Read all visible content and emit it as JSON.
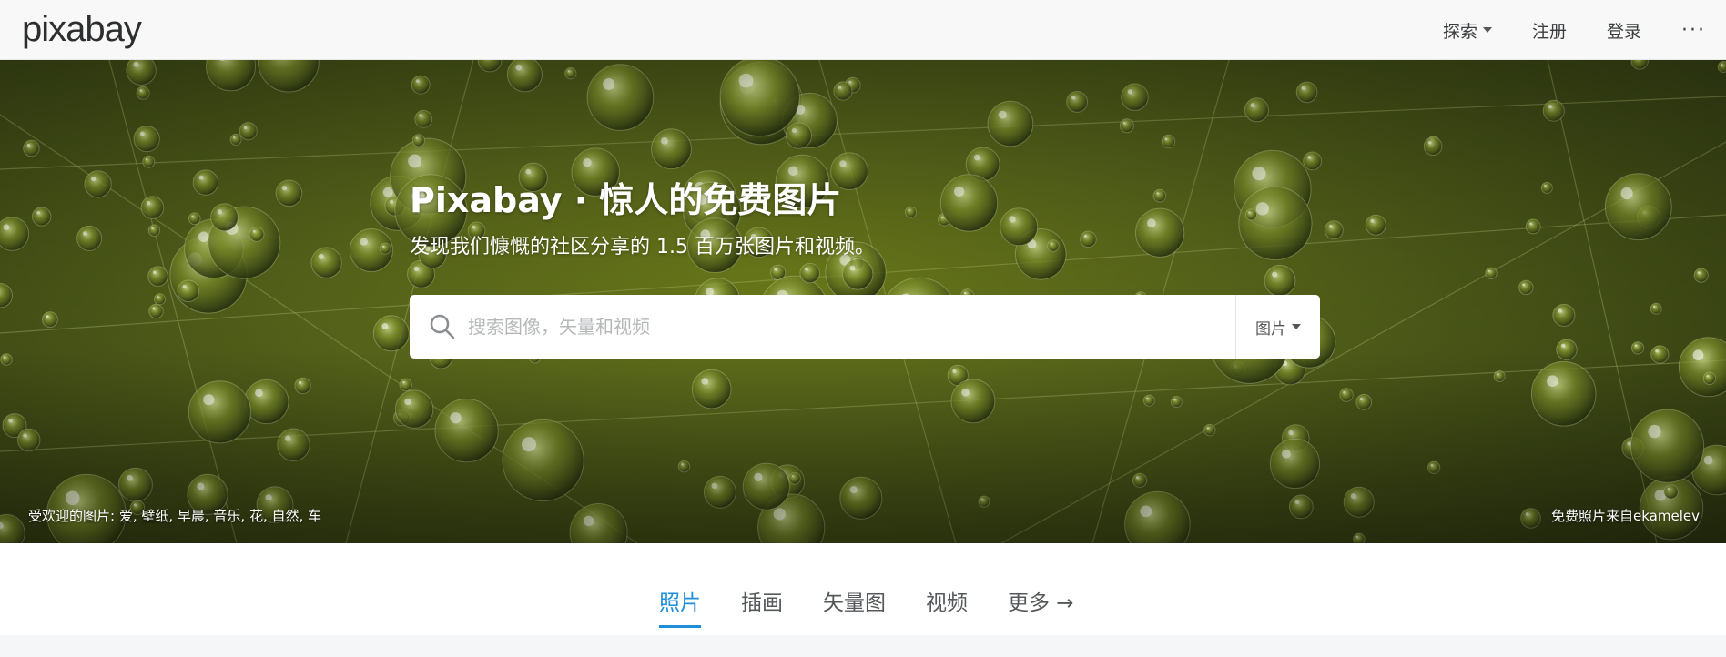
{
  "header": {
    "logo": "pixabay",
    "nav": {
      "explore": "探索",
      "register": "注册",
      "login": "登录",
      "more": "···"
    }
  },
  "hero": {
    "title": "Pixabay · 惊人的免费图片",
    "subtitle": "发现我们慷慨的社区分享的 1.5 百万张图片和视频。",
    "search": {
      "placeholder": "搜索图像，矢量和视频",
      "value": "",
      "type_selected": "图片"
    },
    "popular": "受欢迎的图片: 爱, 壁纸, 早晨, 音乐, 花, 自然, 车",
    "credit": "免费照片来自ekamelev"
  },
  "tabs": {
    "photos": "照片",
    "illustrations": "插画",
    "vectors": "矢量图",
    "videos": "视频",
    "more": "更多 →",
    "active": "照片"
  },
  "colors": {
    "accent": "#1e8fd8",
    "hero_green": "#55631a"
  }
}
